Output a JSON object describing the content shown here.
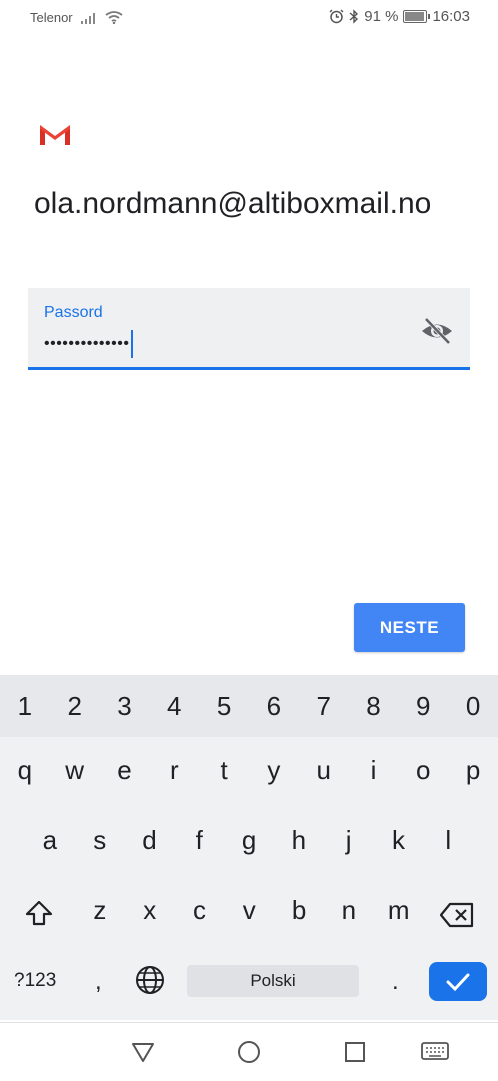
{
  "status_bar": {
    "carrier": "Telenor",
    "battery_percent": "91 %",
    "battery_level": 0.91,
    "time": "16:03",
    "icons": [
      "signal-icon",
      "wifi-icon",
      "alarm-icon",
      "bluetooth-icon",
      "battery-icon"
    ]
  },
  "header": {
    "logo": "gmail-logo",
    "account": "ola.nordmann@altiboxmail.no"
  },
  "password_field": {
    "label": "Passord",
    "value": "••••••••••••••",
    "visibility_icon": "eye-off-icon"
  },
  "next_button": {
    "label": "NESTE"
  },
  "keyboard": {
    "numbers": [
      "1",
      "2",
      "3",
      "4",
      "5",
      "6",
      "7",
      "8",
      "9",
      "0"
    ],
    "row1": [
      "q",
      "w",
      "e",
      "r",
      "t",
      "y",
      "u",
      "i",
      "o",
      "p"
    ],
    "row2": [
      "a",
      "s",
      "d",
      "f",
      "g",
      "h",
      "j",
      "k",
      "l"
    ],
    "row3": [
      "z",
      "x",
      "c",
      "v",
      "b",
      "n",
      "m"
    ],
    "symbols_label": "?123",
    "comma": ",",
    "space_label": "Polski",
    "period": ".",
    "icons": [
      "shift-icon",
      "backspace-icon",
      "globe-icon",
      "checkmark-icon"
    ]
  },
  "nav_bar": {
    "icons": [
      "back-icon",
      "home-icon",
      "recents-icon",
      "keyboard-icon"
    ]
  },
  "colors": {
    "accent": "#1a73e8",
    "button": "#4285f4",
    "field_bg": "#eef0f2",
    "keyboard_bg": "#f0f1f3"
  }
}
